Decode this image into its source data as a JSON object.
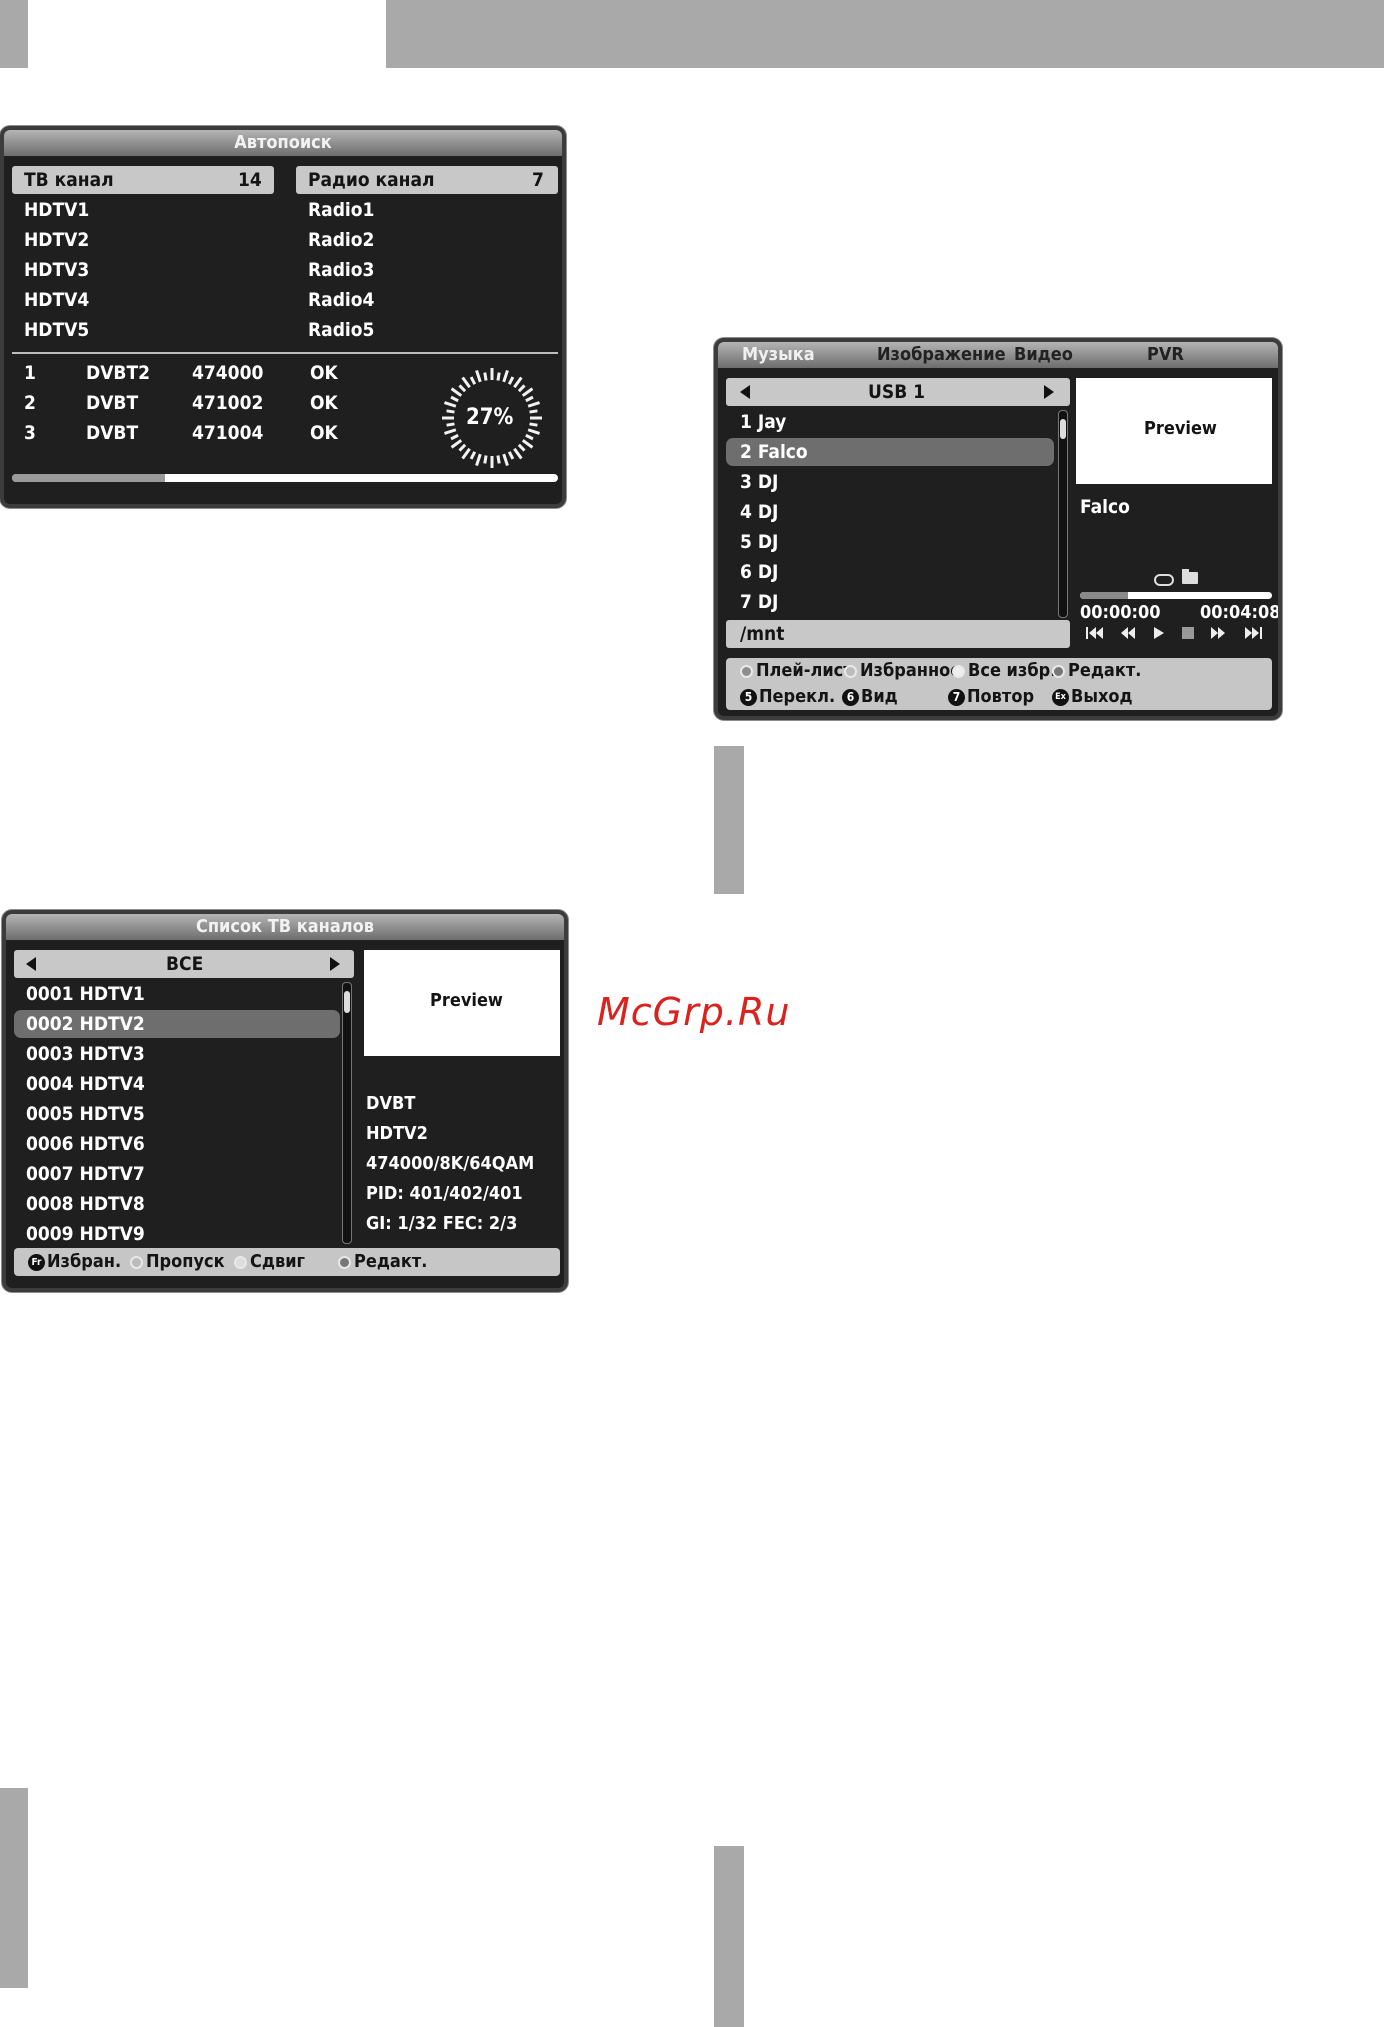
{
  "watermark": "McGrp.Ru",
  "autosearch": {
    "title": "Автопоиск",
    "tv_header": "ТВ канал",
    "tv_count": "14",
    "radio_header": "Радио канал",
    "radio_count": "7",
    "tv_channels": [
      "HDTV1",
      "HDTV2",
      "HDTV3",
      "HDTV4",
      "HDTV5"
    ],
    "radio_channels": [
      "Radio1",
      "Radio2",
      "Radio3",
      "Radio4",
      "Radio5"
    ],
    "scan_rows": [
      {
        "num": "1",
        "type": "DVBT2",
        "freq": "474000",
        "status": "OK"
      },
      {
        "num": "2",
        "type": "DVBT",
        "freq": "471002",
        "status": "OK"
      },
      {
        "num": "3",
        "type": "DVBT",
        "freq": "471004",
        "status": "OK"
      }
    ],
    "percent_label": "27%",
    "progress": 0.28
  },
  "media": {
    "tabs": [
      "Музыка",
      "Изображение",
      "Видео",
      "PVR"
    ],
    "source": "USB 1",
    "tracks": [
      "1 Jay",
      "2 Falco",
      "3 DJ",
      "4 DJ",
      "5 DJ",
      "6 DJ",
      "7 DJ"
    ],
    "selected_track": "2 Falco",
    "path": "/mnt",
    "preview": "Preview",
    "now_playing": "Falco",
    "time_current": "00:00:00",
    "time_total": "00:04:08",
    "progress": 0.25,
    "controls": [
      "prev-track",
      "rewind",
      "play",
      "stop",
      "fast-forward",
      "next-track"
    ],
    "footer_row1": [
      "Плей-лист",
      "Избранное",
      "Все избр.",
      "Редакт."
    ],
    "footer_row2": [
      {
        "key": "5",
        "label": "Перекл."
      },
      {
        "key": "6",
        "label": "Вид"
      },
      {
        "key": "7",
        "label": "Повтор"
      },
      {
        "key": "Ex",
        "label": "Выход"
      }
    ]
  },
  "channel_list": {
    "title": "Список ТВ каналов",
    "filter": "ВСЕ",
    "channels": [
      "0001 HDTV1",
      "0002 HDTV2",
      "0003 HDTV3",
      "0004 HDTV4",
      "0005 HDTV5",
      "0006 HDTV6",
      "0007 HDTV7",
      "0008 HDTV8",
      "0009 HDTV9"
    ],
    "selected": "0002 HDTV2",
    "preview": "Preview",
    "info": [
      "DVBT",
      "HDTV2",
      "474000/8K/64QAM",
      "PID: 401/402/401",
      "GI: 1/32 FEC: 2/3"
    ],
    "footer": [
      {
        "key": "Fr",
        "label": "Избран."
      },
      {
        "key": "",
        "label": "Пропуск"
      },
      {
        "key": "",
        "label": "Сдвиг"
      },
      {
        "key": "",
        "label": "Редакт."
      }
    ]
  }
}
